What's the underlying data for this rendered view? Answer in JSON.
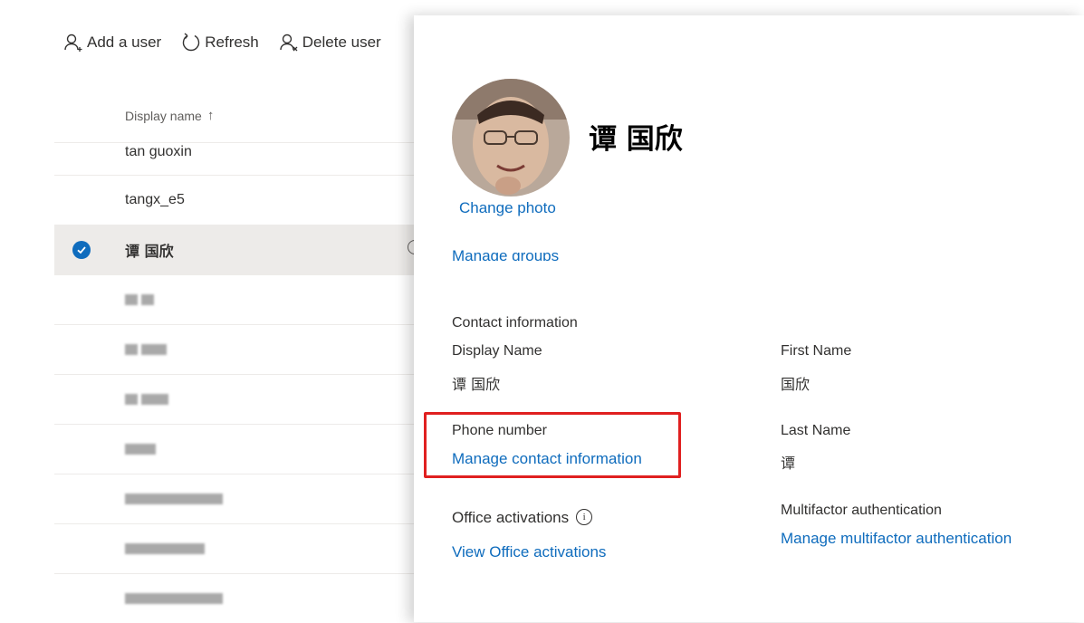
{
  "toolbar": {
    "add_user": "Add a user",
    "refresh": "Refresh",
    "delete_user": "Delete user"
  },
  "list": {
    "header": "Display name",
    "sort_arrow": "↑",
    "rows": [
      "tan guoxin",
      "tangx_e5",
      "谭 国欣"
    ]
  },
  "panel": {
    "user_title": "谭 国欣",
    "change_photo": "Change photo",
    "manage_groups": "Manage groups",
    "contact_info_title": "Contact information",
    "display_name_label": "Display Name",
    "display_name_value": "谭 国欣",
    "first_name_label": "First Name",
    "first_name_value": "国欣",
    "phone_label": "Phone number",
    "phone_link": "Manage contact information",
    "last_name_label": "Last Name",
    "last_name_value": "谭",
    "office_activations_label": "Office activations",
    "office_activations_info": "i",
    "office_activations_link": "View Office activations",
    "mfa_label": "Multifactor authentication",
    "mfa_link": "Manage multifactor authentication"
  },
  "colors": {
    "accent": "#0f6cbd",
    "highlight": "#e02020",
    "selected_row": "#edebe9"
  }
}
